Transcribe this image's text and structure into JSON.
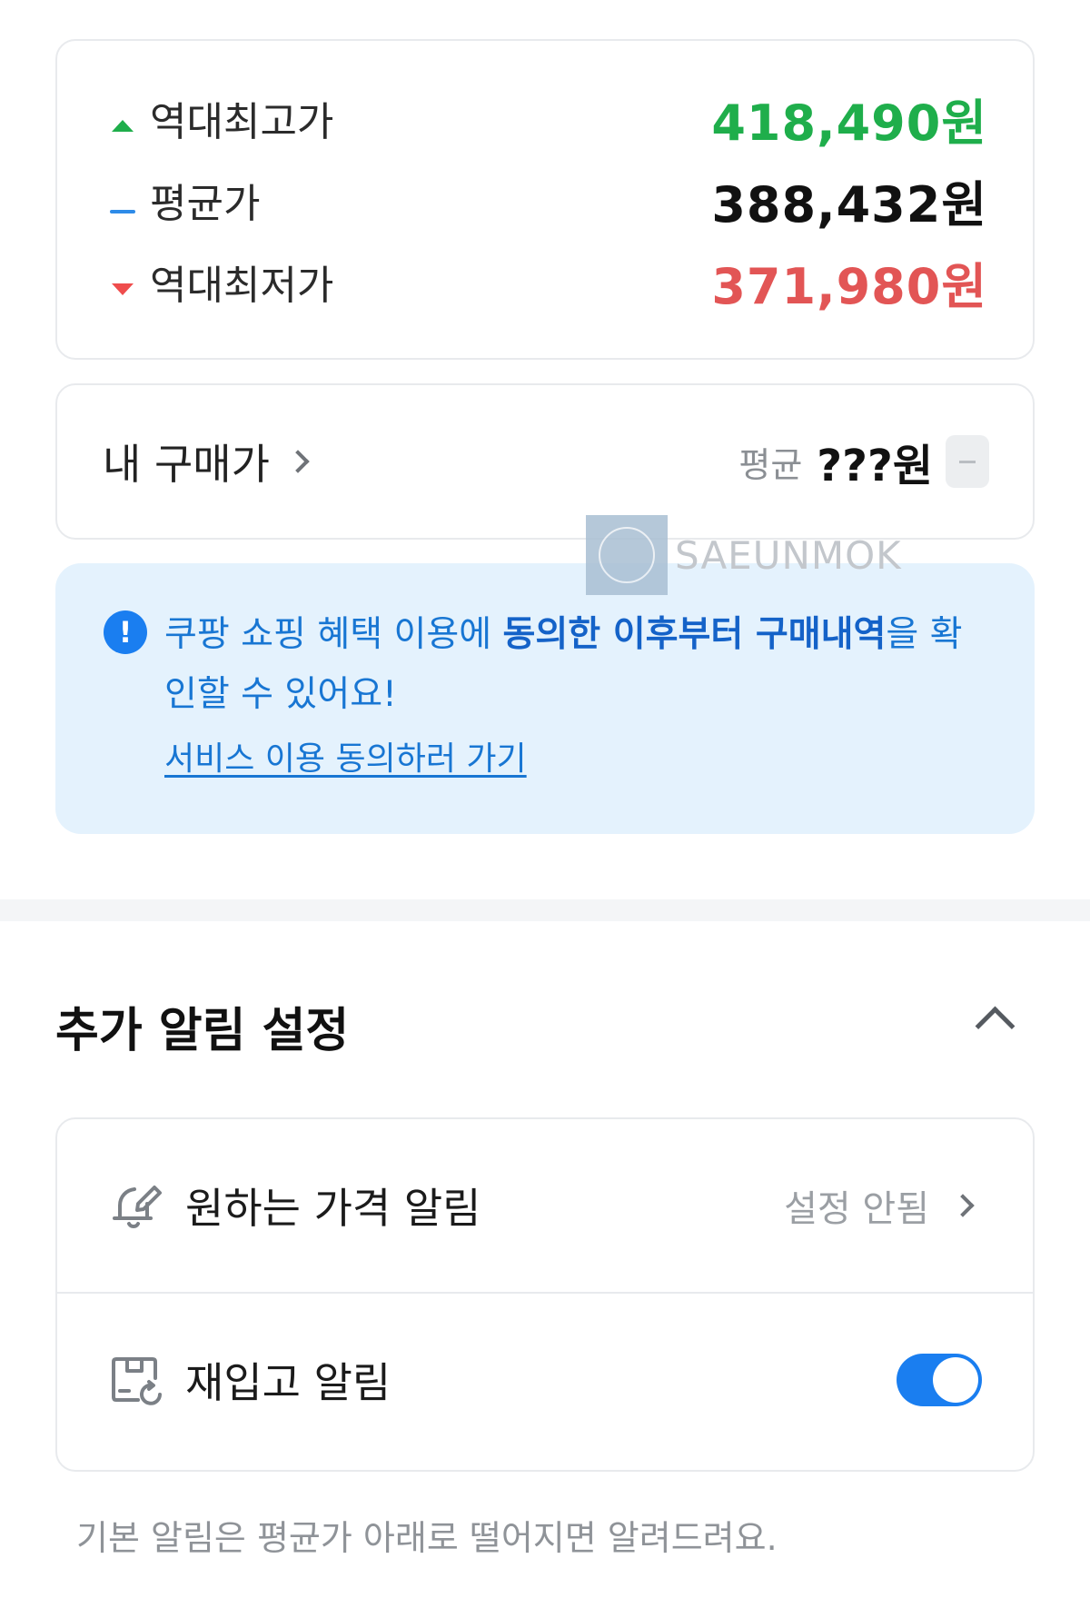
{
  "price_summary": {
    "highest": {
      "label": "역대최고가",
      "value": "418,490원",
      "color": "#1fae4b",
      "icon": "triangle-up-icon"
    },
    "average": {
      "label": "평균가",
      "value": "388,432원",
      "color": "#111111",
      "icon": "dash-icon"
    },
    "lowest": {
      "label": "역대최저가",
      "value": "371,980원",
      "color": "#e25555",
      "icon": "triangle-down-icon"
    }
  },
  "my_purchase": {
    "label": "내 구매가",
    "avg_label": "평균",
    "avg_value": "???원"
  },
  "watermark": {
    "text": "SAEUNMOK"
  },
  "info": {
    "part1": "쿠팡 쇼핑 혜택 이용에 ",
    "bold1": "동의한 이후부터 구매내역",
    "part2": "을 확인할 수 있어요!",
    "link": "서비스 이용 동의하러 가기",
    "accent": "#1a7ef0"
  },
  "section": {
    "title": "추가 알림 설정"
  },
  "alerts": [
    {
      "label": "원하는 가격 알림",
      "status": "설정 안됨",
      "icon": "bell-edit-icon"
    },
    {
      "label": "재입고 알림",
      "toggle_on": true,
      "icon": "box-restock-icon"
    }
  ],
  "footer_note": "기본 알림은 평균가 아래로 떨어지면 알려드려요."
}
